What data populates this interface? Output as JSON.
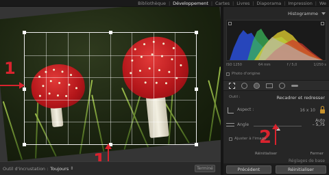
{
  "modules": [
    "Bibliothèque",
    "Développement",
    "Cartes",
    "Livres",
    "Diaporama",
    "Impression",
    "We"
  ],
  "active_module": "Développement",
  "annotations": [
    "1",
    "1",
    "2"
  ],
  "toolbar": {
    "overlay_label": "Outil d'incrustation :",
    "overlay_value": "Toujours",
    "done_label": "Terminé"
  },
  "panel": {
    "histogram_title": "Histogramme",
    "exif": [
      "ISO 1250",
      "64 mm",
      "f / 5,0",
      "1/250 s"
    ],
    "original_photo": "Photo d'origine",
    "tool_label": "Outil :",
    "crop_title": "Recadrer et redresser",
    "aspect_label": "Aspect :",
    "aspect_value": "16 x 10",
    "auto_label": "Auto",
    "angle_label": "Angle",
    "angle_value": "– 5,75",
    "angle_fraction": 0.52,
    "adjust_label": "Ajuster à l'image",
    "reset_link": "Réinitialiser",
    "close_link": "Fermer",
    "basic_label": "Réglages de base"
  },
  "buttons": {
    "previous": "Précédent",
    "reset": "Réinitialiser"
  },
  "colors": {
    "accent_red": "#d9232e",
    "lock": "#c8922c"
  }
}
